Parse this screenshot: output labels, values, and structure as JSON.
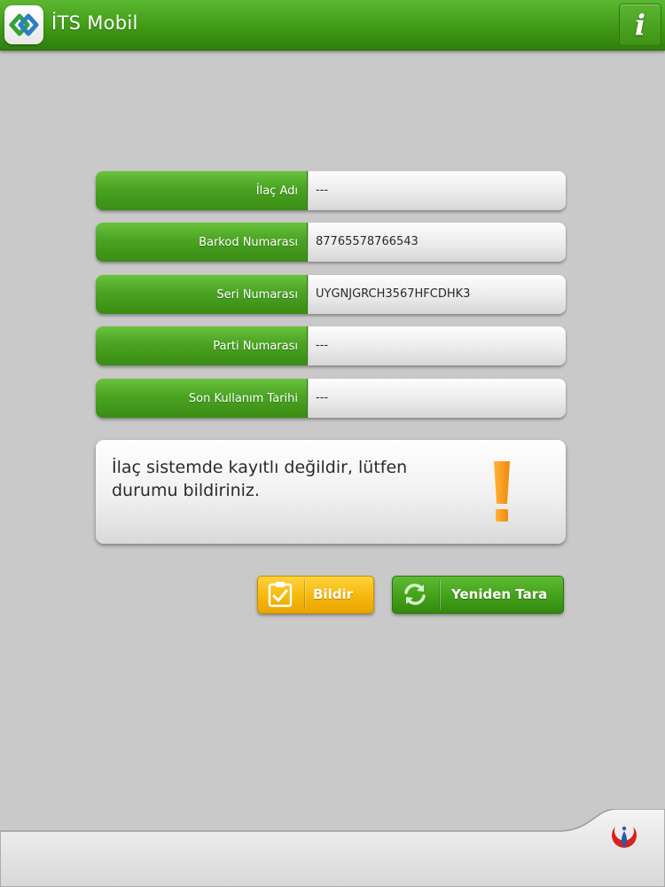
{
  "header": {
    "title": "İTS Mobil",
    "info_icon": "info-icon",
    "accent_color": "#3f9a16"
  },
  "fields": [
    {
      "label": "İlaç Adı",
      "value": "---"
    },
    {
      "label": "Barkod Numarası",
      "value": "87765578766543"
    },
    {
      "label": "Seri Numarası",
      "value": "UYGNJGRCH3567HFCDHK3"
    },
    {
      "label": "Parti Numarası",
      "value": "---"
    },
    {
      "label": "Son Kullanım Tarihi",
      "value": "---"
    }
  ],
  "message": {
    "text": "İlaç sistemde kayıtlı değildir, lütfen durumu bildiriniz.",
    "icon": "exclamation-icon",
    "icon_color": "#f7a21b"
  },
  "buttons": {
    "report": {
      "label": "Bildir",
      "icon": "clipboard-check-icon",
      "color": "#f6b80d"
    },
    "rescan": {
      "label": "Yeniden Tara",
      "icon": "refresh-icon",
      "color": "#43a01a"
    }
  },
  "footer": {
    "logo": "ministry-logo"
  }
}
